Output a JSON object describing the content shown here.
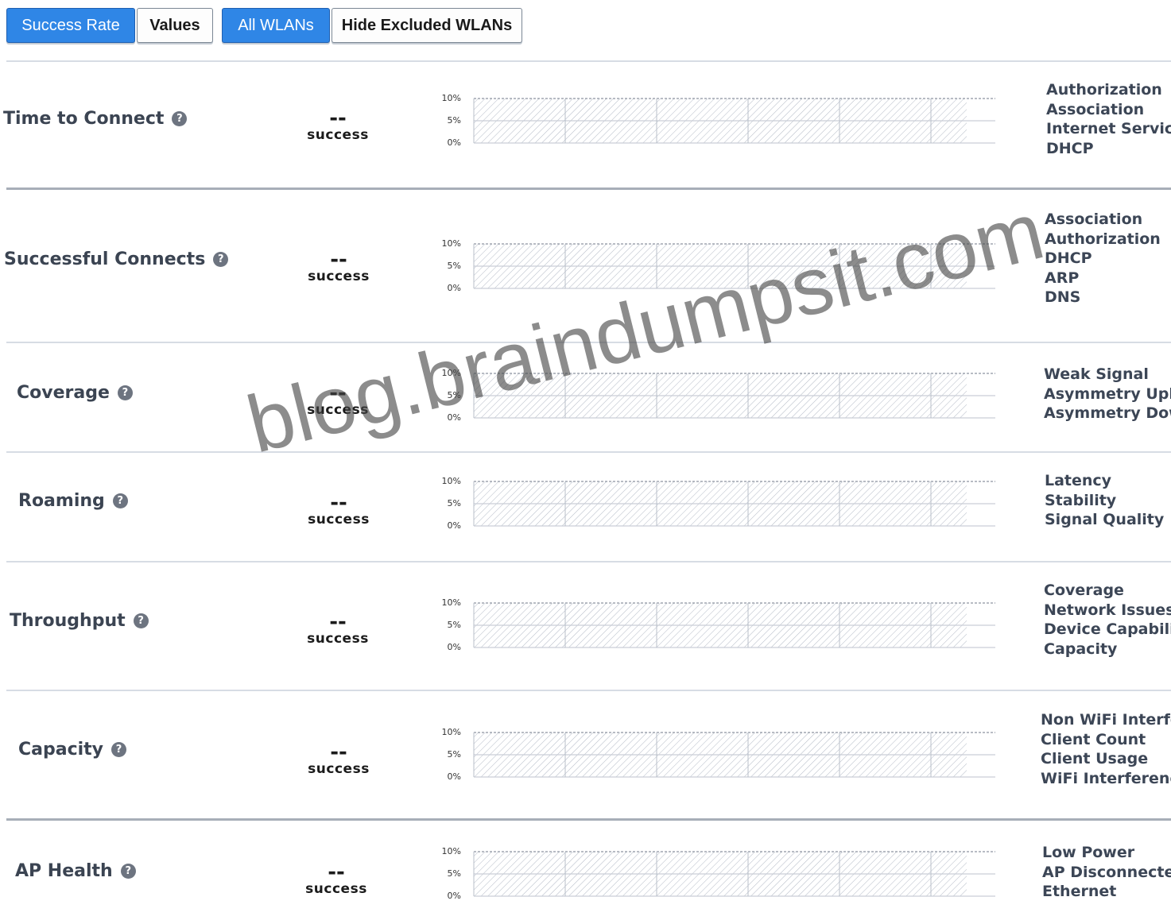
{
  "toolbar": {
    "metric_toggle": {
      "selected": "Success Rate",
      "success_rate": "Success Rate",
      "values": "Values"
    },
    "wlan_toggle": {
      "selected": "All WLANs",
      "all_wlans": "All WLANs",
      "hide_excluded": "Hide Excluded WLANs"
    }
  },
  "y_ticks": [
    "10%",
    "5%",
    "0%"
  ],
  "metrics": [
    {
      "name": "Time to Connect",
      "value": "--",
      "unit": "success",
      "reasons": [
        "Authorization",
        "Association",
        "Internet Services",
        "DHCP"
      ]
    },
    {
      "name": "Successful Connects",
      "value": "--",
      "unit": "success",
      "reasons": [
        "Association",
        "Authorization",
        "DHCP",
        "ARP",
        "DNS"
      ]
    },
    {
      "name": "Coverage",
      "value": "--",
      "unit": "success",
      "reasons": [
        "Weak Signal",
        "Asymmetry Uplink",
        "Asymmetry Downlink"
      ]
    },
    {
      "name": "Roaming",
      "value": "--",
      "unit": "success",
      "reasons": [
        "Latency",
        "Stability",
        "Signal Quality"
      ]
    },
    {
      "name": "Throughput",
      "value": "--",
      "unit": "success",
      "reasons": [
        "Coverage",
        "Network Issues",
        "Device Capability",
        "Capacity"
      ]
    },
    {
      "name": "Capacity",
      "value": "--",
      "unit": "success",
      "reasons": [
        "Non WiFi Interference",
        "Client Count",
        "Client Usage",
        "WiFi Interference"
      ]
    },
    {
      "name": "AP Health",
      "value": "--",
      "unit": "success",
      "reasons": [
        "Low Power",
        "AP Disconnected",
        "Ethernet"
      ]
    }
  ],
  "watermark": "blog.braindumpsit.com",
  "colors": {
    "active_button": "#2f86e6",
    "hatch": "#9aa3b3",
    "grid": "#c9ced6"
  }
}
